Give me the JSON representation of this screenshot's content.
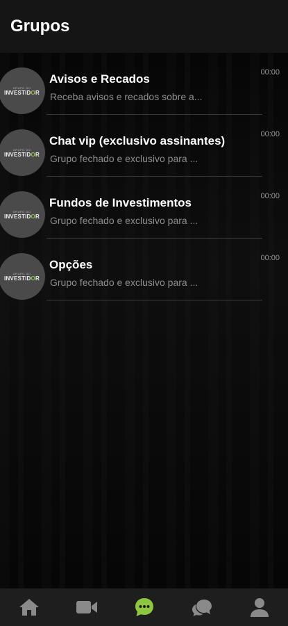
{
  "header": {
    "title": "Grupos"
  },
  "groups": [
    {
      "title": "Avisos e Recados",
      "preview": "Receba avisos e recados sobre a...",
      "time": "00:00"
    },
    {
      "title": "Chat vip (exclusivo assinantes)",
      "preview": "Grupo fechado e exclusivo para ...",
      "time": "00:00"
    },
    {
      "title": "Fundos de Investimentos",
      "preview": "Grupo fechado e exclusivo para ...",
      "time": "00:00"
    },
    {
      "title": "Opções",
      "preview": "Grupo fechado e exclusivo para ...",
      "time": "00:00"
    }
  ],
  "avatar": {
    "small_text": "GRUPO DO",
    "logo_prefix": "INVESTID",
    "logo_o": "O",
    "logo_suffix": "R"
  },
  "tabs": [
    {
      "name": "home-icon",
      "active": false
    },
    {
      "name": "video-icon",
      "active": false
    },
    {
      "name": "chat-icon",
      "active": true
    },
    {
      "name": "forum-icon",
      "active": false
    },
    {
      "name": "profile-icon",
      "active": false
    }
  ],
  "colors": {
    "accent": "#8dc63f",
    "inactive": "#8a8a8a",
    "header_bg": "#151515",
    "tabbar_bg": "#1e1e1e"
  }
}
